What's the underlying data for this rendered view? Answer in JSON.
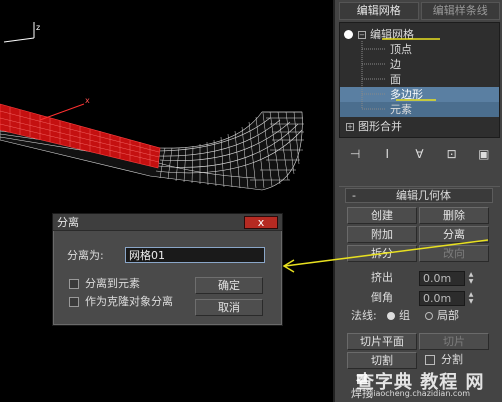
{
  "panel": {
    "tabs": [
      "编辑网格",
      "编辑样条线"
    ],
    "stack": {
      "items": [
        "编辑网格",
        "顶点",
        "边",
        "面",
        "多边形",
        "元素",
        "图形合并"
      ]
    },
    "rollout": {
      "minus": "-",
      "title": "编辑几何体",
      "create": "创建",
      "delete": "删除",
      "attach": "附加",
      "detach": "分离",
      "split": "拆分",
      "turn": "改向",
      "extrude": "挤出",
      "extrude_val": "0.0m",
      "chamfer": "倒角",
      "chamfer_val": "0.0m",
      "normal_label": "法线:",
      "normal_group": "组",
      "normal_local": "局部",
      "slice_plane": "切片平面",
      "slice": "切片",
      "cut": "切割",
      "split_chk": "分割",
      "weld": "焊接"
    }
  },
  "dialog": {
    "title": "分离",
    "close": "x",
    "name_label": "分离为:",
    "name_value": "网格01",
    "chk_element": "分离到元素",
    "chk_clone": "作为克隆对象分离",
    "ok": "确定",
    "cancel": "取消"
  },
  "watermark": {
    "text": "查字典 教程 网",
    "url": "jiaocheng.chazidian.com"
  },
  "colors": {
    "highlight_line": "#e8e020",
    "mesh_red": "#d01010",
    "selection_blue": "#5a7fa2"
  }
}
